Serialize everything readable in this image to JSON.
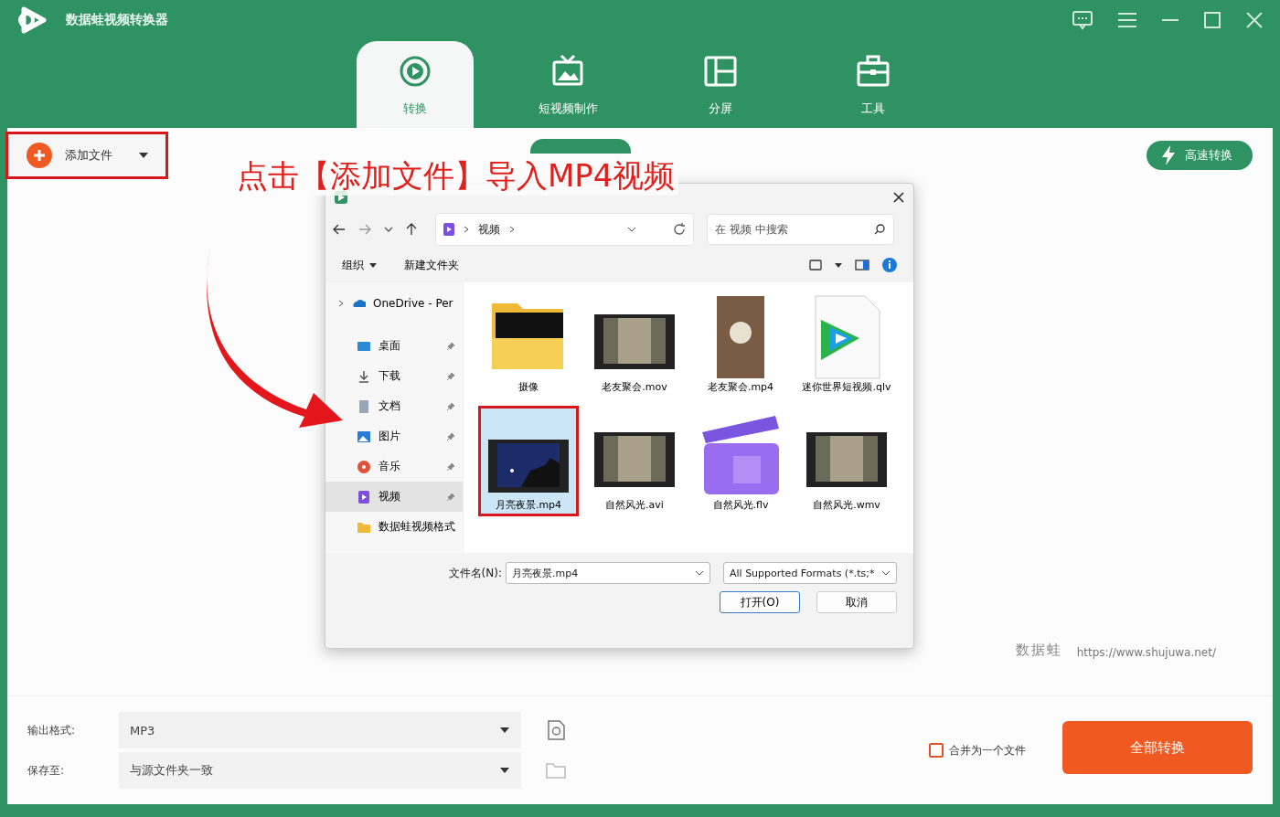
{
  "window": {
    "title": "数据蛙视频转换器"
  },
  "tabs": [
    {
      "label": "转换",
      "kind": "convert",
      "selected": true
    },
    {
      "label": "短视频制作",
      "kind": "tv",
      "selected": false
    },
    {
      "label": "分屏",
      "kind": "split",
      "selected": false
    },
    {
      "label": "工具",
      "kind": "toolbox",
      "selected": false
    }
  ],
  "toolbar": {
    "add_button": {
      "label": "添加文件",
      "highlighted": true
    },
    "speed_button": "高速转换"
  },
  "annotation": {
    "text": "点击【添加文件】导入MP4视频"
  },
  "dialog": {
    "breadcrumb": "视频",
    "search": {
      "placeholder": "在 视频 中搜索"
    },
    "commands": [
      {
        "label": "组织",
        "dropdown": true
      },
      {
        "label": "新建文件夹",
        "dropdown": false
      }
    ],
    "sidebar": [
      {
        "label": "OneDrive - Per",
        "kind": "cloud",
        "pinned": false,
        "selected": false
      },
      {
        "label": "桌面",
        "kind": "desktop",
        "pinned": true,
        "selected": false
      },
      {
        "label": "下载",
        "kind": "download",
        "pinned": true,
        "selected": false
      },
      {
        "label": "文档",
        "kind": "document",
        "pinned": true,
        "selected": false
      },
      {
        "label": "图片",
        "kind": "picture",
        "pinned": true,
        "selected": false
      },
      {
        "label": "音乐",
        "kind": "music",
        "pinned": true,
        "selected": false
      },
      {
        "label": "视频",
        "kind": "video",
        "pinned": true,
        "selected": true
      },
      {
        "label": "数据蛙视频格式",
        "kind": "folder",
        "pinned": false,
        "selected": false
      }
    ],
    "files": [
      {
        "name": "摄像",
        "kind": "folder",
        "selected": false,
        "highlighted": false
      },
      {
        "name": "老友聚会.mov",
        "kind": "video",
        "selected": false,
        "highlighted": false
      },
      {
        "name": "老友聚会.mp4",
        "kind": "photo",
        "selected": false,
        "highlighted": false
      },
      {
        "name": "迷你世界短视频.qlv",
        "kind": "qlv",
        "selected": false,
        "highlighted": false
      },
      {
        "name": "月亮夜景.mp4",
        "kind": "night",
        "selected": true,
        "highlighted": true
      },
      {
        "name": "自然风光.avi",
        "kind": "video",
        "selected": false,
        "highlighted": false
      },
      {
        "name": "自然风光.flv",
        "kind": "clapper",
        "selected": false,
        "highlighted": false
      },
      {
        "name": "自然风光.wmv",
        "kind": "video",
        "selected": false,
        "highlighted": false
      }
    ],
    "filename_label": "文件名(N):",
    "filename": "月亮夜景.mp4",
    "filter": "All Supported Formats (*.ts;*",
    "buttons": [
      "打开(O)",
      "取消"
    ]
  },
  "brand": {
    "name": "数据蛙",
    "url": "https://www.shujuwa.net/"
  },
  "output": {
    "format_label": "输出格式:",
    "format": "MP3",
    "save_label": "保存至:",
    "save_value": "与源文件夹一致"
  },
  "merge": {
    "label": "合并为一个文件",
    "checked": false
  },
  "convert_all": "全部转换"
}
